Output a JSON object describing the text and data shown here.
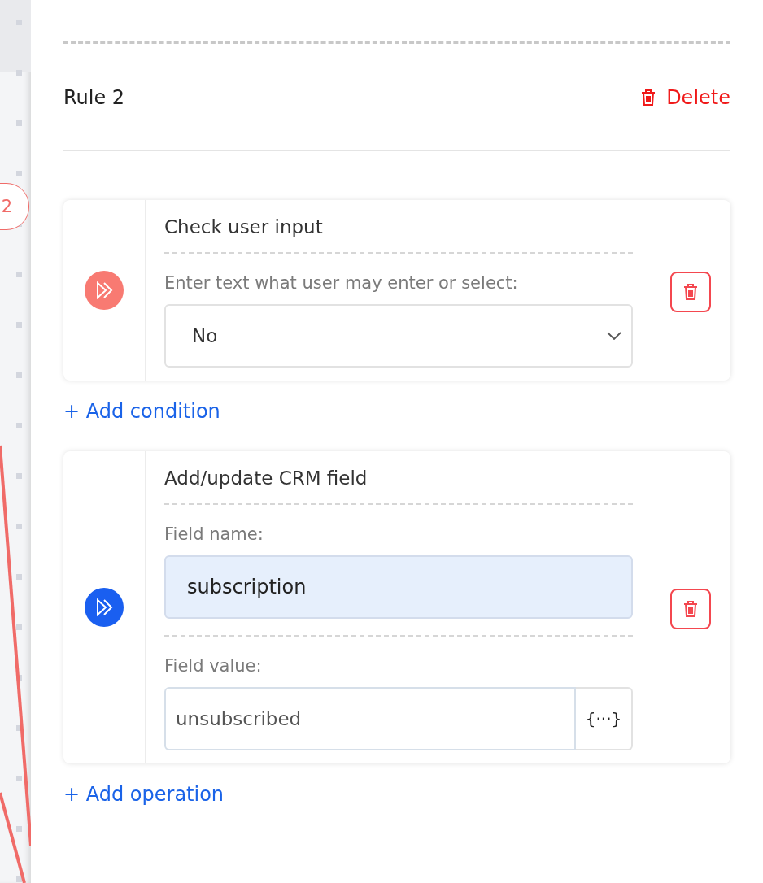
{
  "canvas": {
    "node_label": "2"
  },
  "rule": {
    "title": "Rule 2",
    "delete_label": "Delete"
  },
  "sections": [
    {
      "kind": "condition",
      "title": "Check user input",
      "add_label": "+ Add condition",
      "fields": [
        {
          "kind": "select",
          "label": "Enter text what user may enter or select:",
          "value": "No"
        }
      ]
    },
    {
      "kind": "operation",
      "title": "Add/update CRM field",
      "add_label": "+ Add operation",
      "fields": [
        {
          "kind": "input",
          "label": "Field name:",
          "value": "subscription",
          "highlighted": true
        },
        {
          "kind": "variable",
          "label": "Field value:",
          "value": "unsubscribed",
          "highlighted": false,
          "button": "{···}"
        }
      ]
    }
  ]
}
